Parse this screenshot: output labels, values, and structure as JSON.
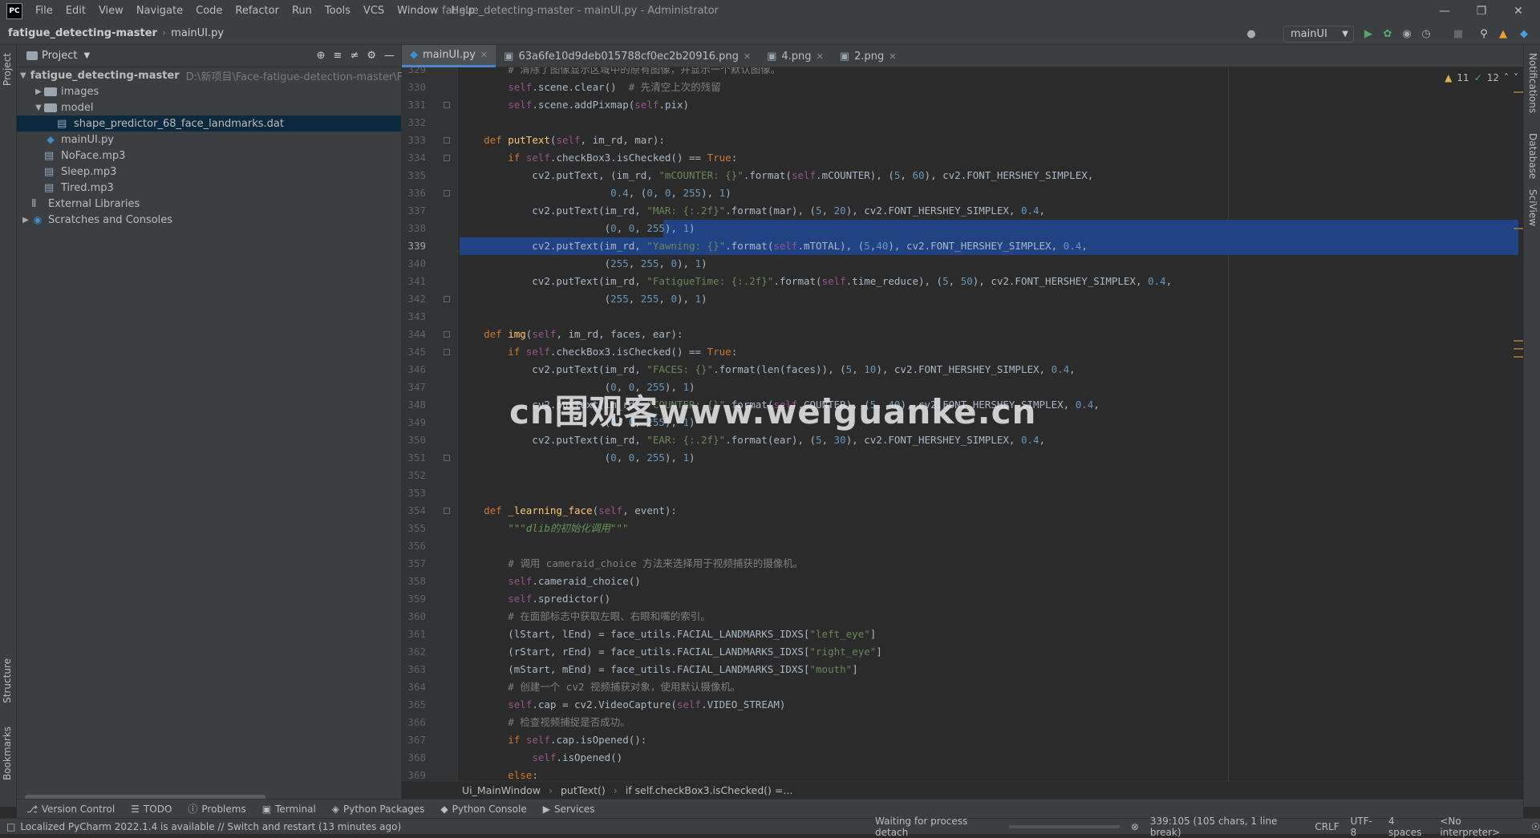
{
  "app": {
    "logo": "PC",
    "title": "fatigue_detecting-master - mainUI.py - Administrator"
  },
  "menu": [
    "File",
    "Edit",
    "View",
    "Navigate",
    "Code",
    "Refactor",
    "Run",
    "Tools",
    "VCS",
    "Window",
    "Help"
  ],
  "nav": {
    "project": "fatigue_detecting-master",
    "file": "mainUI.py",
    "run_config": "mainUI"
  },
  "project_panel": {
    "title": "Project",
    "tree": [
      {
        "label": "fatigue_detecting-master",
        "extra": "D:\\新项目\\Face-fatigue-detection-master\\Face-fa",
        "type": "folder",
        "expanded": true
      },
      {
        "label": "images",
        "type": "folder",
        "expanded": false
      },
      {
        "label": "model",
        "type": "folder",
        "expanded": true
      },
      {
        "label": "shape_predictor_68_face_landmarks.dat",
        "type": "file",
        "selected": true
      },
      {
        "label": "mainUI.py",
        "type": "py"
      },
      {
        "label": "NoFace.mp3",
        "type": "file"
      },
      {
        "label": "Sleep.mp3",
        "type": "file"
      },
      {
        "label": "Tired.mp3",
        "type": "file"
      },
      {
        "label": "External Libraries",
        "type": "lib"
      },
      {
        "label": "Scratches and Consoles",
        "type": "scratch"
      }
    ]
  },
  "tabs": [
    {
      "label": "mainUI.py",
      "active": true
    },
    {
      "label": "63a6fe10d9deb015788cf0ec2b20916.png",
      "active": false
    },
    {
      "label": "4.png",
      "active": false
    },
    {
      "label": "2.png",
      "active": false
    }
  ],
  "inspections": {
    "warnings": "11",
    "ok": "12"
  },
  "editor": {
    "current_line": "339",
    "lines": [
      {
        "n": "329",
        "html": "        <span class='cm'># 清除了图像显示区域中的原有图像，并显示一个默认图像。</span>"
      },
      {
        "n": "330",
        "html": "        <span class='sf'>self</span>.scene.clear()  <span class='cm'># 先清空上次的残留</span>"
      },
      {
        "n": "331",
        "html": "        <span class='sf'>self</span>.scene.addPixmap(<span class='sf'>self</span>.pix)"
      },
      {
        "n": "332",
        "html": ""
      },
      {
        "n": "333",
        "html": "    <span class='kw'>def</span> <span class='fn'>putText</span>(<span class='sf'>self</span>, im_rd, mar):"
      },
      {
        "n": "334",
        "html": "        <span class='kw'>if</span> <span class='sf'>self</span>.checkBox3.isChecked() == <span class='kw'>True</span>:"
      },
      {
        "n": "335",
        "html": "            cv2.putText, (im_rd, <span class='st'>\"mCOUNTER: {}\"</span>.format(<span class='sf'>self</span>.mCOUNTER), (<span class='nm'>5</span>, <span class='nm'>60</span>), cv2.FONT_HERSHEY_SIMPLEX,"
      },
      {
        "n": "336",
        "html": "                         <span class='nm'>0.4</span>, (<span class='nm'>0</span>, <span class='nm'>0</span>, <span class='nm'>255</span>), <span class='nm'>1</span>)"
      },
      {
        "n": "337",
        "html": "            cv2.putText(im_rd, <span class='st'>\"MAR: {:.2f}\"</span>.format(mar), (<span class='nm'>5</span>, <span class='nm'>20</span>), cv2.FONT_HERSHEY_SIMPLEX, <span class='nm'>0.4</span>,"
      },
      {
        "n": "338",
        "html": "                        (<span class='nm'>0</span>, <span class='nm'>0</span>, <span class='nm'>255</span>), <span class='nm'>1</span>)"
      },
      {
        "n": "339",
        "html": "            cv2.putText(im_rd, <span class='st'>\"Yawning: {}\"</span>.format(<span class='sf'>self</span>.mTOTAL), (<span class='nm'>5</span>,<span class='nm'>40</span>), cv2.FONT_HERSHEY_SIMPLEX, <span class='nm'>0.4</span>,"
      },
      {
        "n": "340",
        "html": "                        (<span class='nm'>255</span>, <span class='nm'>255</span>, <span class='nm'>0</span>), <span class='nm'>1</span>)"
      },
      {
        "n": "341",
        "html": "            cv2.putText(im_rd, <span class='st'>\"FatigueTime: {:.2f}\"</span>.format(<span class='sf'>self</span>.time_reduce), (<span class='nm'>5</span>, <span class='nm'>50</span>), cv2.FONT_HERSHEY_SIMPLEX, <span class='nm'>0.4</span>,"
      },
      {
        "n": "342",
        "html": "                        (<span class='nm'>255</span>, <span class='nm'>255</span>, <span class='nm'>0</span>), <span class='nm'>1</span>)"
      },
      {
        "n": "343",
        "html": ""
      },
      {
        "n": "344",
        "html": "    <span class='kw'>def</span> <span class='fn'>img</span>(<span class='sf'>self</span>, im_rd, faces, ear):"
      },
      {
        "n": "345",
        "html": "        <span class='kw'>if</span> <span class='sf'>self</span>.checkBox3.isChecked() == <span class='kw'>True</span>:"
      },
      {
        "n": "346",
        "html": "            cv2.putText(im_rd, <span class='st'>\"FACES: {}\"</span>.format(len(faces)), (<span class='nm'>5</span>, <span class='nm'>10</span>), cv2.FONT_HERSHEY_SIMPLEX, <span class='nm'>0.4</span>,"
      },
      {
        "n": "347",
        "html": "                        (<span class='nm'>0</span>, <span class='nm'>0</span>, <span class='nm'>255</span>), <span class='nm'>1</span>)"
      },
      {
        "n": "348",
        "html": "            cv2.putText(im_rd, <span class='st'>\"COUNTER: {}\"</span>.format(<span class='sf'>self</span>.COUNTER), (<span class='nm'>5</span>, <span class='nm'>40</span>), cv2.FONT_HERSHEY_SIMPLEX, <span class='nm'>0.4</span>,"
      },
      {
        "n": "349",
        "html": "                        (<span class='nm'>0</span>, <span class='nm'>0</span>, <span class='nm'>255</span>), <span class='nm'>1</span>)"
      },
      {
        "n": "350",
        "html": "            cv2.putText(im_rd, <span class='st'>\"EAR: {:.2f}\"</span>.format(ear), (<span class='nm'>5</span>, <span class='nm'>30</span>), cv2.FONT_HERSHEY_SIMPLEX, <span class='nm'>0.4</span>,"
      },
      {
        "n": "351",
        "html": "                        (<span class='nm'>0</span>, <span class='nm'>0</span>, <span class='nm'>255</span>), <span class='nm'>1</span>)"
      },
      {
        "n": "352",
        "html": ""
      },
      {
        "n": "353",
        "html": ""
      },
      {
        "n": "354",
        "html": "    <span class='kw'>def</span> <span class='fn'>_learning_face</span>(<span class='sf'>self</span>, event):"
      },
      {
        "n": "355",
        "html": "        <span class='ds'>\"\"\"dlib的初始化调用\"\"\"</span>"
      },
      {
        "n": "356",
        "html": ""
      },
      {
        "n": "357",
        "html": "        <span class='cm'># 调用 cameraid_choice 方法来选择用于视频捕获的摄像机。</span>"
      },
      {
        "n": "358",
        "html": "        <span class='sf'>self</span>.cameraid_choice()"
      },
      {
        "n": "359",
        "html": "        <span class='sf'>self</span>.spredictor()"
      },
      {
        "n": "360",
        "html": "        <span class='cm'># 在面部标志中获取左眼、右眼和嘴的索引。</span>"
      },
      {
        "n": "361",
        "html": "        (lStart, lEnd) = face_utils.FACIAL_LANDMARKS_IDXS[<span class='st'>\"left_eye\"</span>]"
      },
      {
        "n": "362",
        "html": "        (rStart, rEnd) = face_utils.FACIAL_LANDMARKS_IDXS[<span class='st'>\"right_eye\"</span>]"
      },
      {
        "n": "363",
        "html": "        (mStart, mEnd) = face_utils.FACIAL_LANDMARKS_IDXS[<span class='st'>\"mouth\"</span>]"
      },
      {
        "n": "364",
        "html": "        <span class='cm'># 创建一个 cv2 视频捕获对象，使用默认摄像机。</span>"
      },
      {
        "n": "365",
        "html": "        <span class='sf'>self</span>.cap = cv2.VideoCapture(<span class='sf'>self</span>.VIDEO_STREAM)"
      },
      {
        "n": "366",
        "html": "        <span class='cm'># 检查视频捕捉是否成功。</span>"
      },
      {
        "n": "367",
        "html": "        <span class='kw'>if</span> <span class='sf'>self</span>.cap.isOpened():"
      },
      {
        "n": "368",
        "html": "            <span class='sf'>self</span>.isOpened()"
      },
      {
        "n": "369",
        "html": "        <span class='kw'>else</span>:"
      }
    ]
  },
  "breadcrumb": [
    "Ui_MainWindow",
    "putText()",
    "if self.checkBox3.isChecked() =..."
  ],
  "toolwindows": [
    "Version Control",
    "TODO",
    "Problems",
    "Terminal",
    "Python Packages",
    "Python Console",
    "Services"
  ],
  "left_strip": [
    "Project",
    "Structure",
    "Bookmarks"
  ],
  "right_strip": [
    "Notifications",
    "Database",
    "SciView"
  ],
  "status": {
    "message": "Localized PyCharm 2022.1.4 is available // Switch and restart (13 minutes ago)",
    "process": "Waiting for process detach",
    "position": "339:105 (105 chars, 1 line break)",
    "line_sep": "CRLF",
    "encoding": "UTF-8",
    "indent": "4 spaces",
    "interpreter": "<No interpreter>"
  },
  "watermark": "cn围观客www.weiguanke.cn"
}
